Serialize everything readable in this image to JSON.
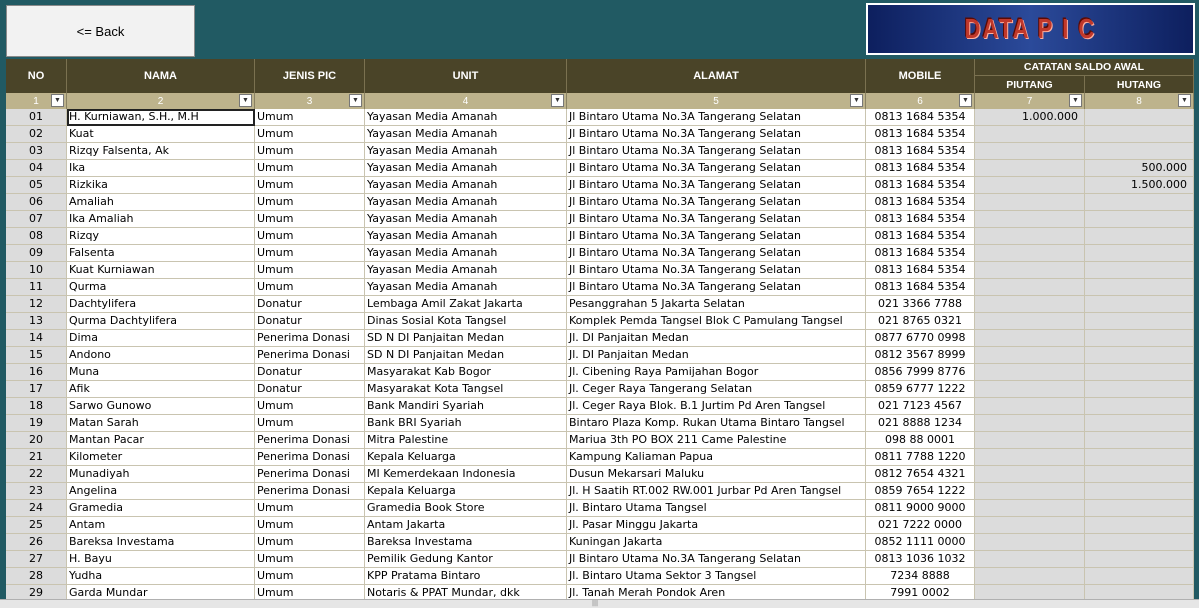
{
  "back_button": "<= Back",
  "banner_title": "DATA P I C",
  "headers": {
    "no": "NO",
    "nama": "NAMA",
    "jenis": "JENIS PIC",
    "unit": "UNIT",
    "alamat": "ALAMAT",
    "mobile": "MOBILE",
    "group": "CATATAN SALDO AWAL",
    "piutang": "PIUTANG",
    "hutang": "HUTANG"
  },
  "col_numbers": [
    "1",
    "2",
    "3",
    "4",
    "5",
    "6",
    "7",
    "8"
  ],
  "rows": [
    {
      "no": "01",
      "nama": "H. Kurniawan, S.H., M.H",
      "jenis": "Umum",
      "unit": "Yayasan Media Amanah",
      "alamat": "Jl Bintaro Utama No.3A Tangerang Selatan",
      "mobile": "0813 1684 5354",
      "piutang": "1.000.000",
      "hutang": ""
    },
    {
      "no": "02",
      "nama": "Kuat",
      "jenis": "Umum",
      "unit": "Yayasan Media Amanah",
      "alamat": "Jl Bintaro Utama No.3A Tangerang Selatan",
      "mobile": "0813 1684 5354",
      "piutang": "",
      "hutang": ""
    },
    {
      "no": "03",
      "nama": "Rizqy Falsenta, Ak",
      "jenis": "Umum",
      "unit": "Yayasan Media Amanah",
      "alamat": "Jl Bintaro Utama No.3A Tangerang Selatan",
      "mobile": "0813 1684 5354",
      "piutang": "",
      "hutang": ""
    },
    {
      "no": "04",
      "nama": "Ika",
      "jenis": "Umum",
      "unit": "Yayasan Media Amanah",
      "alamat": "Jl Bintaro Utama No.3A Tangerang Selatan",
      "mobile": "0813 1684 5354",
      "piutang": "",
      "hutang": "500.000"
    },
    {
      "no": "05",
      "nama": "Rizkika",
      "jenis": "Umum",
      "unit": "Yayasan Media Amanah",
      "alamat": "Jl Bintaro Utama No.3A Tangerang Selatan",
      "mobile": "0813 1684 5354",
      "piutang": "",
      "hutang": "1.500.000"
    },
    {
      "no": "06",
      "nama": "Amaliah",
      "jenis": "Umum",
      "unit": "Yayasan Media Amanah",
      "alamat": "Jl Bintaro Utama No.3A Tangerang Selatan",
      "mobile": "0813 1684 5354",
      "piutang": "",
      "hutang": ""
    },
    {
      "no": "07",
      "nama": "Ika Amaliah",
      "jenis": "Umum",
      "unit": "Yayasan Media Amanah",
      "alamat": "Jl Bintaro Utama No.3A Tangerang Selatan",
      "mobile": "0813 1684 5354",
      "piutang": "",
      "hutang": ""
    },
    {
      "no": "08",
      "nama": "Rizqy",
      "jenis": "Umum",
      "unit": "Yayasan Media Amanah",
      "alamat": "Jl Bintaro Utama No.3A Tangerang Selatan",
      "mobile": "0813 1684 5354",
      "piutang": "",
      "hutang": ""
    },
    {
      "no": "09",
      "nama": "Falsenta",
      "jenis": "Umum",
      "unit": "Yayasan Media Amanah",
      "alamat": "Jl Bintaro Utama No.3A Tangerang Selatan",
      "mobile": "0813 1684 5354",
      "piutang": "",
      "hutang": ""
    },
    {
      "no": "10",
      "nama": "Kuat Kurniawan",
      "jenis": "Umum",
      "unit": "Yayasan Media Amanah",
      "alamat": "Jl Bintaro Utama No.3A Tangerang Selatan",
      "mobile": "0813 1684 5354",
      "piutang": "",
      "hutang": ""
    },
    {
      "no": "11",
      "nama": "Qurma",
      "jenis": "Umum",
      "unit": "Yayasan Media Amanah",
      "alamat": "Jl Bintaro Utama No.3A Tangerang Selatan",
      "mobile": "0813 1684 5354",
      "piutang": "",
      "hutang": ""
    },
    {
      "no": "12",
      "nama": "Dachtylifera",
      "jenis": "Donatur",
      "unit": "Lembaga Amil Zakat Jakarta",
      "alamat": "Pesanggrahan 5 Jakarta Selatan",
      "mobile": "021 3366 7788",
      "piutang": "",
      "hutang": ""
    },
    {
      "no": "13",
      "nama": "Qurma Dachtylifera",
      "jenis": "Donatur",
      "unit": "Dinas Sosial Kota Tangsel",
      "alamat": "Komplek Pemda Tangsel Blok C Pamulang Tangsel",
      "mobile": "021 8765 0321",
      "piutang": "",
      "hutang": ""
    },
    {
      "no": "14",
      "nama": "Dima",
      "jenis": "Penerima Donasi",
      "unit": "SD N DI Panjaitan Medan",
      "alamat": "Jl. DI Panjaitan Medan",
      "mobile": "0877 6770 0998",
      "piutang": "",
      "hutang": ""
    },
    {
      "no": "15",
      "nama": "Andono",
      "jenis": "Penerima Donasi",
      "unit": "SD N DI Panjaitan Medan",
      "alamat": "Jl. DI Panjaitan Medan",
      "mobile": "0812 3567 8999",
      "piutang": "",
      "hutang": ""
    },
    {
      "no": "16",
      "nama": "Muna",
      "jenis": "Donatur",
      "unit": "Masyarakat Kab Bogor",
      "alamat": "Jl. Cibening Raya Pamijahan Bogor",
      "mobile": "0856 7999 8776",
      "piutang": "",
      "hutang": ""
    },
    {
      "no": "17",
      "nama": "Afik",
      "jenis": "Donatur",
      "unit": "Masyarakat Kota Tangsel",
      "alamat": "Jl. Ceger Raya Tangerang Selatan",
      "mobile": "0859 6777 1222",
      "piutang": "",
      "hutang": ""
    },
    {
      "no": "18",
      "nama": "Sarwo Gunowo",
      "jenis": "Umum",
      "unit": "Bank Mandiri Syariah",
      "alamat": "Jl. Ceger Raya Blok. B.1 Jurtim Pd Aren Tangsel",
      "mobile": "021 7123 4567",
      "piutang": "",
      "hutang": ""
    },
    {
      "no": "19",
      "nama": "Matan Sarah",
      "jenis": "Umum",
      "unit": "Bank BRI Syariah",
      "alamat": "Bintaro Plaza Komp. Rukan Utama Bintaro Tangsel",
      "mobile": "021 8888  1234",
      "piutang": "",
      "hutang": ""
    },
    {
      "no": "20",
      "nama": "Mantan Pacar",
      "jenis": "Penerima Donasi",
      "unit": "Mitra Palestine",
      "alamat": "Mariua 3th PO BOX 211  Came Palestine",
      "mobile": "098 88 0001",
      "piutang": "",
      "hutang": ""
    },
    {
      "no": "21",
      "nama": "Kilometer",
      "jenis": "Penerima Donasi",
      "unit": "Kepala Keluarga",
      "alamat": "Kampung Kaliaman Papua",
      "mobile": "0811 7788 1220",
      "piutang": "",
      "hutang": ""
    },
    {
      "no": "22",
      "nama": "Munadiyah",
      "jenis": "Penerima Donasi",
      "unit": "MI Kemerdekaan Indonesia",
      "alamat": "Dusun Mekarsari Maluku",
      "mobile": "0812 7654 4321",
      "piutang": "",
      "hutang": ""
    },
    {
      "no": "23",
      "nama": "Angelina",
      "jenis": "Penerima Donasi",
      "unit": "Kepala Keluarga",
      "alamat": "Jl. H Saatih RT.002 RW.001 Jurbar Pd Aren Tangsel",
      "mobile": "0859 7654 1222",
      "piutang": "",
      "hutang": ""
    },
    {
      "no": "24",
      "nama": "Gramedia",
      "jenis": "Umum",
      "unit": "Gramedia Book Store",
      "alamat": "Jl. Bintaro Utama Tangsel",
      "mobile": "0811 9000 9000",
      "piutang": "",
      "hutang": ""
    },
    {
      "no": "25",
      "nama": "Antam",
      "jenis": "Umum",
      "unit": "Antam Jakarta",
      "alamat": "Jl. Pasar Minggu Jakarta",
      "mobile": "021 7222 0000",
      "piutang": "",
      "hutang": ""
    },
    {
      "no": "26",
      "nama": "Bareksa Investama",
      "jenis": "Umum",
      "unit": "Bareksa Investama",
      "alamat": "Kuningan Jakarta",
      "mobile": "0852 1111 0000",
      "piutang": "",
      "hutang": ""
    },
    {
      "no": "27",
      "nama": "H. Bayu",
      "jenis": "Umum",
      "unit": "Pemilik Gedung Kantor",
      "alamat": "Jl Bintaro Utama No.3A Tangerang Selatan",
      "mobile": "0813 1036 1032",
      "piutang": "",
      "hutang": ""
    },
    {
      "no": "28",
      "nama": "Yudha",
      "jenis": "Umum",
      "unit": "KPP Pratama Bintaro",
      "alamat": "Jl. Bintaro Utama Sektor 3 Tangsel",
      "mobile": "7234 8888",
      "piutang": "",
      "hutang": ""
    },
    {
      "no": "29",
      "nama": "Garda Mundar",
      "jenis": "Umum",
      "unit": "Notaris & PPAT Mundar, dkk",
      "alamat": "Jl. Tanah Merah Pondok Aren",
      "mobile": "7991 0002",
      "piutang": "",
      "hutang": ""
    }
  ],
  "colors": {
    "header_bg": "#4a4428",
    "numbers_bg": "#bdb38c",
    "background": "#215a63",
    "banner_text": "#c0382b"
  }
}
